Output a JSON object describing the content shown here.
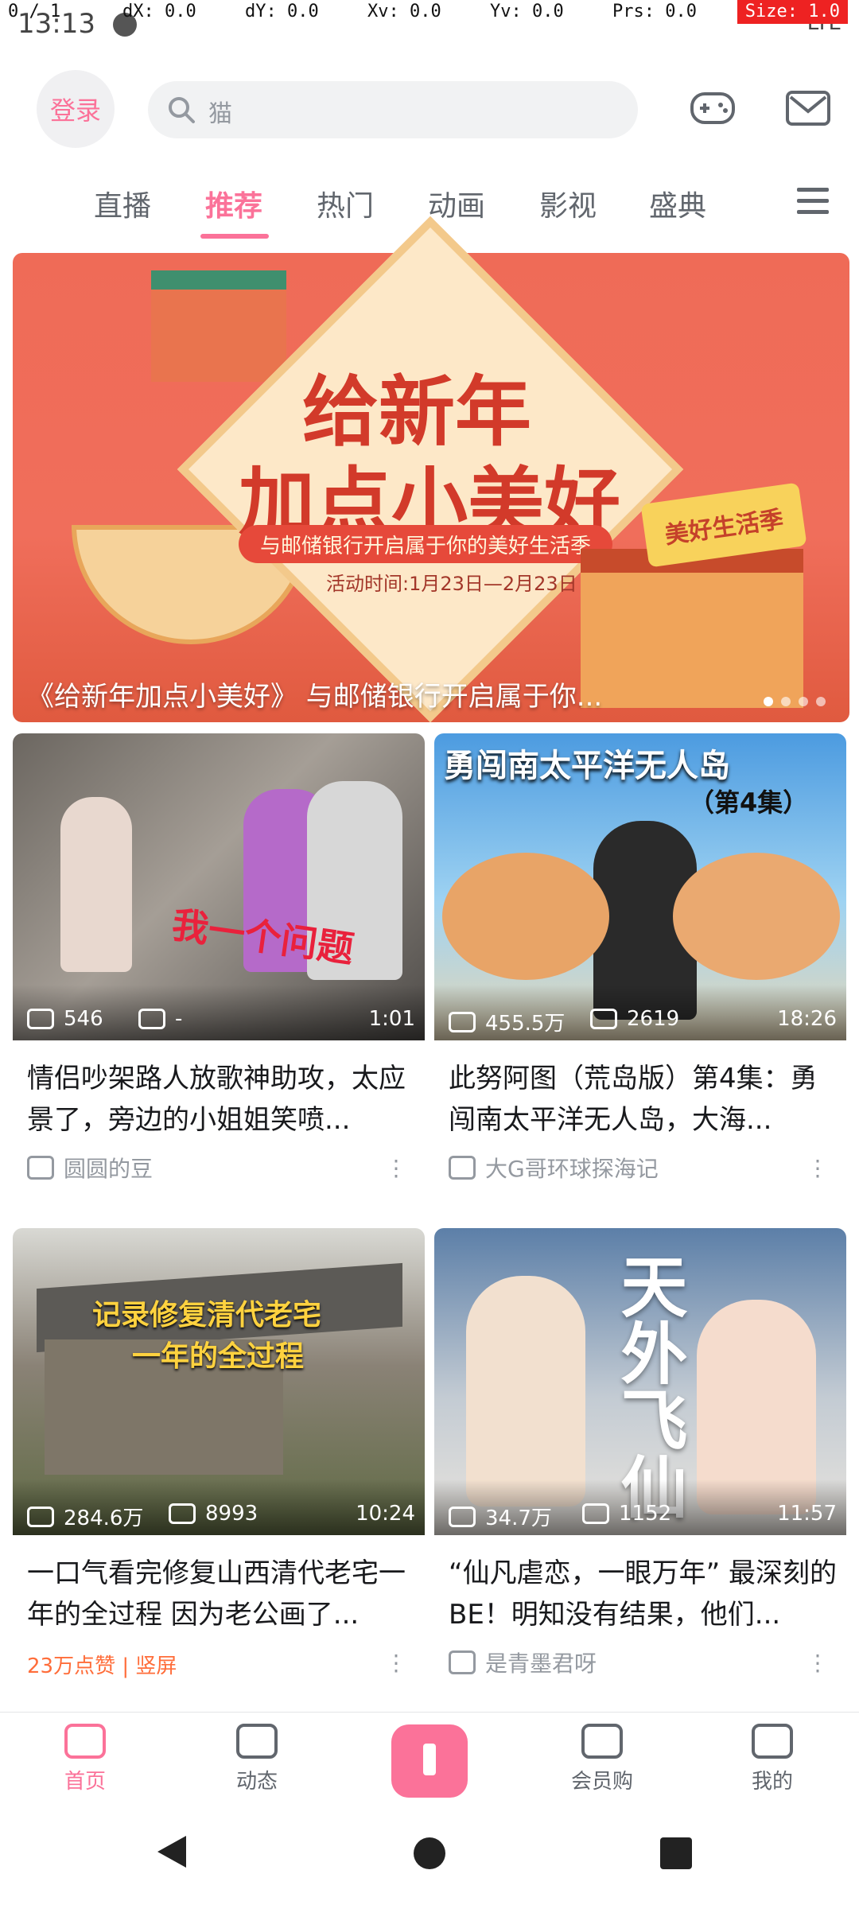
{
  "debug": {
    "p": "0 / 1",
    "dx": "dX: 0.0",
    "dy": "dY: 0.0",
    "xv": "Xv: 0.0",
    "yv": "Yv: 0.0",
    "prs": "Prs: 0.0",
    "size": "Size: 1.0"
  },
  "status_bar": {
    "time": "13:13",
    "right": "LTE"
  },
  "header": {
    "login_label": "登录",
    "search_placeholder": "猫"
  },
  "tabs": [
    {
      "label": "直播"
    },
    {
      "label": "推荐"
    },
    {
      "label": "热门"
    },
    {
      "label": "动画"
    },
    {
      "label": "影视"
    },
    {
      "label": "盛典"
    }
  ],
  "banner": {
    "title_line1": "给新年",
    "title_line2": "加点小美好",
    "pill": "与邮储银行开启属于你的美好生活季",
    "date": "活动时间:1月23日—2月23日",
    "sign": "美好生活季",
    "caption": "《给新年加点小美好》 与邮储银行开启属于你..."
  },
  "cards": [
    {
      "views": "546",
      "danmaku": "-",
      "duration": "1:01",
      "title": "情侣吵架路人放歌神助攻，太应景了，旁边的小姐姐笑喷...",
      "author": "圆圆的豆",
      "overlay": "我一个问题"
    },
    {
      "views": "455.5万",
      "danmaku": "2619",
      "duration": "18:26",
      "title": "此努阿图（荒岛版）第4集：勇闯南太平洋无人岛，大海...",
      "author": "大G哥环球探海记",
      "overlay": "勇闯南太平洋无人岛",
      "overlay2": "（第4集）"
    },
    {
      "views": "284.6万",
      "danmaku": "8993",
      "duration": "10:24",
      "title": "一口气看完修复山西清代老宅一年的全过程 因为老公画了...",
      "tag": "23万点赞 | 竖屏",
      "overlay": "记录修复清代老宅",
      "overlay2": "一年的全过程"
    },
    {
      "views": "34.7万",
      "danmaku": "1152",
      "duration": "11:57",
      "title": "“仙凡虐恋，一眼万年” 最深刻的BE！明知没有结果，他们...",
      "author": "是青墨君呀",
      "overlay": "天外飞仙"
    }
  ],
  "bottom_nav": [
    {
      "label": "首页"
    },
    {
      "label": "动态"
    },
    {
      "label": "会员购"
    },
    {
      "label": "我的"
    }
  ],
  "colors": {
    "accent": "#fb7299",
    "text_secondary": "#9499a0"
  }
}
